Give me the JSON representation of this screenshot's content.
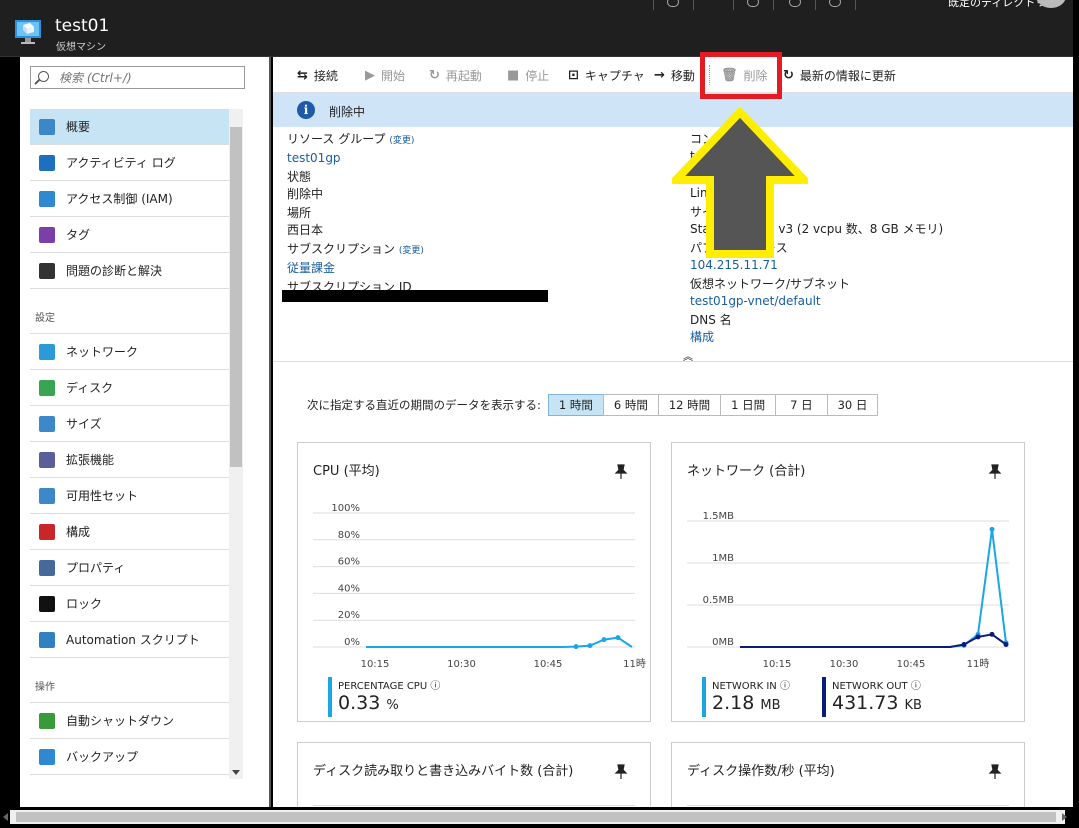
{
  "header": {
    "title": "test01",
    "subtitle": "仮想マシン",
    "user_name": "既定のディレクトリ"
  },
  "search": {
    "placeholder": "検索 (Ctrl+/)"
  },
  "menu": [
    {
      "label": "概要",
      "icon": "vm-icon",
      "color": "#3c87c8",
      "active": true
    },
    {
      "label": "アクティビティ ログ",
      "icon": "activity-log-icon",
      "color": "#1f6fbf"
    },
    {
      "label": "アクセス制御 (IAM)",
      "icon": "iam-icon",
      "color": "#2f89d0"
    },
    {
      "label": "タグ",
      "icon": "tag-icon",
      "color": "#7b3fa8"
    },
    {
      "label": "問題の診断と解決",
      "icon": "tools-icon",
      "color": "#333333"
    },
    {
      "section": "設定"
    },
    {
      "label": "ネットワーク",
      "icon": "network-icon",
      "color": "#2c9ad6"
    },
    {
      "label": "ディスク",
      "icon": "disk-icon",
      "color": "#3aa550"
    },
    {
      "label": "サイズ",
      "icon": "size-icon",
      "color": "#3c87c8"
    },
    {
      "label": "拡張機能",
      "icon": "extensions-icon",
      "color": "#5a5f99"
    },
    {
      "label": "可用性セット",
      "icon": "availability-icon",
      "color": "#3c87c8"
    },
    {
      "label": "構成",
      "icon": "toolbox-icon",
      "color": "#c8262b"
    },
    {
      "label": "プロパティ",
      "icon": "properties-icon",
      "color": "#456a9a"
    },
    {
      "label": "ロック",
      "icon": "lock-icon",
      "color": "#111111"
    },
    {
      "label": "Automation スクリプト",
      "icon": "script-icon",
      "color": "#2f7fc1"
    },
    {
      "section": "操作"
    },
    {
      "label": "自動シャットダウン",
      "icon": "clock-icon",
      "color": "#3a9a3a"
    },
    {
      "label": "バックアップ",
      "icon": "backup-icon",
      "color": "#2f89d0"
    }
  ],
  "toolbar": {
    "connect": "接続",
    "start": "開始",
    "restart": "再起動",
    "stop": "停止",
    "capture": "キャプチャ",
    "move": "移動",
    "delete": "削除",
    "refresh": "最新の情報に更新"
  },
  "notice": {
    "text": "削除中"
  },
  "essentials": {
    "resource_group_label": "リソース グループ",
    "change": "(変更)",
    "resource_group": "test01gp",
    "status_label": "状態",
    "status": "削除中",
    "location_label": "場所",
    "location": "西日本",
    "subscription_label": "サブスクリプション",
    "subscription": "従量課金",
    "subscription_id_label": "サブスクリプション ID",
    "computer_label": "コン",
    "computer_value": "t",
    "os_label": "Lin",
    "size_label": "サイ",
    "size_value": "Sta                  v3 (2 vcpu 数、8 GB メモリ)",
    "public_ip_label": "パブ             レス",
    "public_ip": "104.215.11.71",
    "vnet_label": "仮想ネットワーク/サブネット",
    "vnet": "test01gp-vnet/default",
    "dns_label": "DNS 名",
    "dns": "構成"
  },
  "time_range": {
    "label": "次に指定する直近の期間のデータを表示する:",
    "options": [
      "1 時間",
      "6 時間",
      "12 時間",
      "1 日間",
      "7 日",
      "30 日"
    ],
    "selected": "1 時間"
  },
  "cards": {
    "cpu": {
      "title": "CPU (平均)",
      "metric_label": "PERCENTAGE CPU",
      "value": "0.33",
      "unit": "%"
    },
    "network": {
      "title": "ネットワーク (合計)",
      "in_label": "NETWORK IN",
      "in_value": "2.18",
      "in_unit": "MB",
      "out_label": "NETWORK OUT",
      "out_value": "431.73",
      "out_unit": "KB"
    },
    "disk_bytes": {
      "title": "ディスク読み取りと書き込みバイト数 (合計)"
    },
    "disk_ops": {
      "title": "ディスク操作数/秒 (平均)"
    }
  },
  "chart_data": [
    {
      "type": "line",
      "title": "CPU (平均)",
      "x": [
        "10:15",
        "10:30",
        "10:45",
        "11時"
      ],
      "y_ticks": [
        "0%",
        "20%",
        "40%",
        "60%",
        "80%",
        "100%"
      ],
      "ylim": [
        0,
        100
      ],
      "series": [
        {
          "name": "PERCENTAGE CPU",
          "color": "#1aa6e6",
          "values": [
            0,
            0,
            0,
            0,
            0,
            0,
            0,
            0,
            0,
            0,
            0,
            0,
            0,
            0,
            0,
            0.3,
            1,
            5.5,
            7,
            0
          ]
        }
      ]
    },
    {
      "type": "line",
      "title": "ネットワーク (合計)",
      "x": [
        "10:15",
        "10:30",
        "10:45",
        "11時"
      ],
      "y_ticks": [
        "0MB",
        "0.5MB",
        "1MB",
        "1.5MB"
      ],
      "ylim": [
        0,
        1.5
      ],
      "series": [
        {
          "name": "NETWORK IN",
          "color": "#1aa6e6",
          "values": [
            0,
            0,
            0,
            0,
            0,
            0,
            0,
            0,
            0,
            0,
            0,
            0,
            0,
            0,
            0,
            0,
            0.02,
            0.15,
            1.4,
            0.05
          ]
        },
        {
          "name": "NETWORK OUT",
          "color": "#0b1b7c",
          "values": [
            0,
            0,
            0,
            0,
            0,
            0,
            0,
            0,
            0,
            0,
            0,
            0,
            0,
            0,
            0,
            0,
            0.03,
            0.12,
            0.15,
            0.03
          ]
        }
      ]
    }
  ]
}
